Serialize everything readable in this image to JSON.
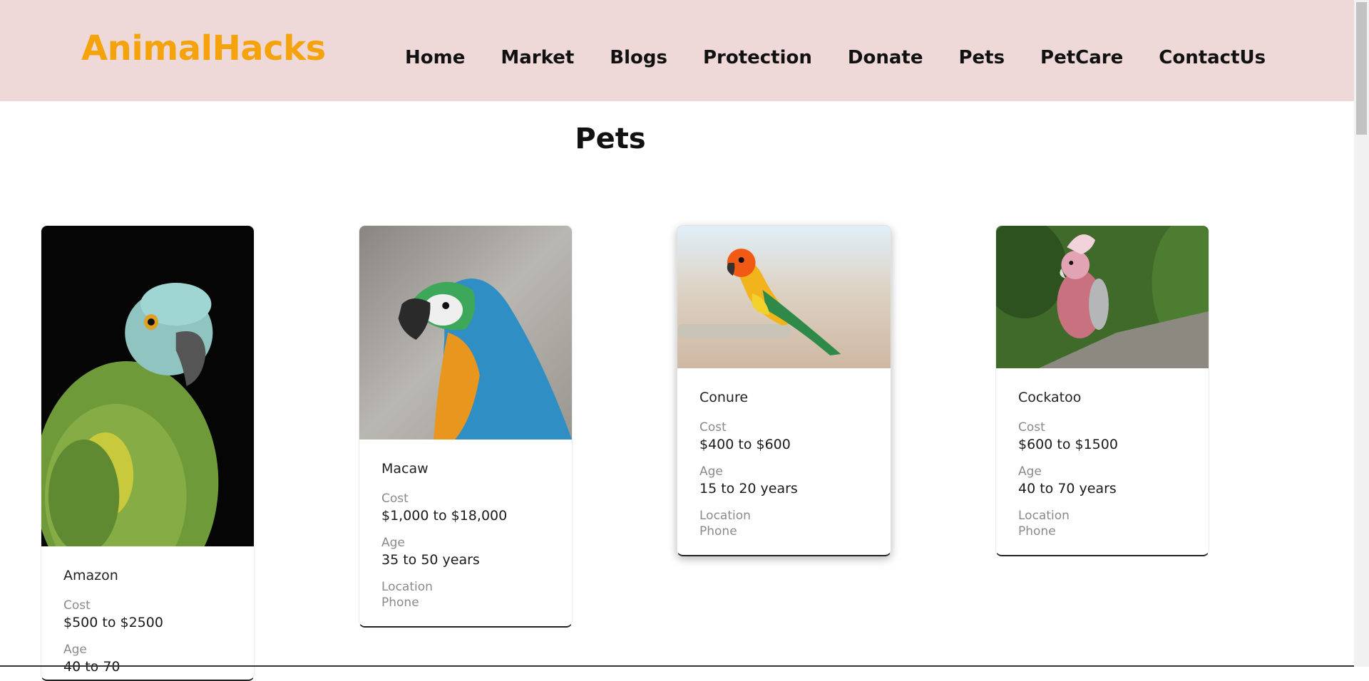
{
  "header": {
    "logo": "AnimalHacks",
    "nav": [
      "Home",
      "Market",
      "Blogs",
      "Protection",
      "Donate",
      "Pets",
      "PetCare",
      "ContactUs"
    ]
  },
  "page": {
    "title": "Pets"
  },
  "cards": [
    {
      "name": "Amazon",
      "cost_label": "Cost",
      "cost": "$500 to $2500",
      "age_label": "Age",
      "age": "40 to 70"
    },
    {
      "name": "Macaw",
      "cost_label": "Cost",
      "cost": "$1,000 to $18,000",
      "age_label": "Age",
      "age": "35 to 50 years",
      "location_label": "Location",
      "phone_label": "Phone"
    },
    {
      "name": "Conure",
      "cost_label": "Cost",
      "cost": "$400 to $600",
      "age_label": "Age",
      "age": "15 to 20 years",
      "location_label": "Location",
      "phone_label": "Phone"
    },
    {
      "name": "Cockatoo",
      "cost_label": "Cost",
      "cost": "$600 to $1500",
      "age_label": "Age",
      "age": "40 to 70 years",
      "location_label": "Location",
      "phone_label": "Phone"
    }
  ],
  "colors": {
    "header_bg": "#eed8d8",
    "logo": "#f5a30c"
  }
}
